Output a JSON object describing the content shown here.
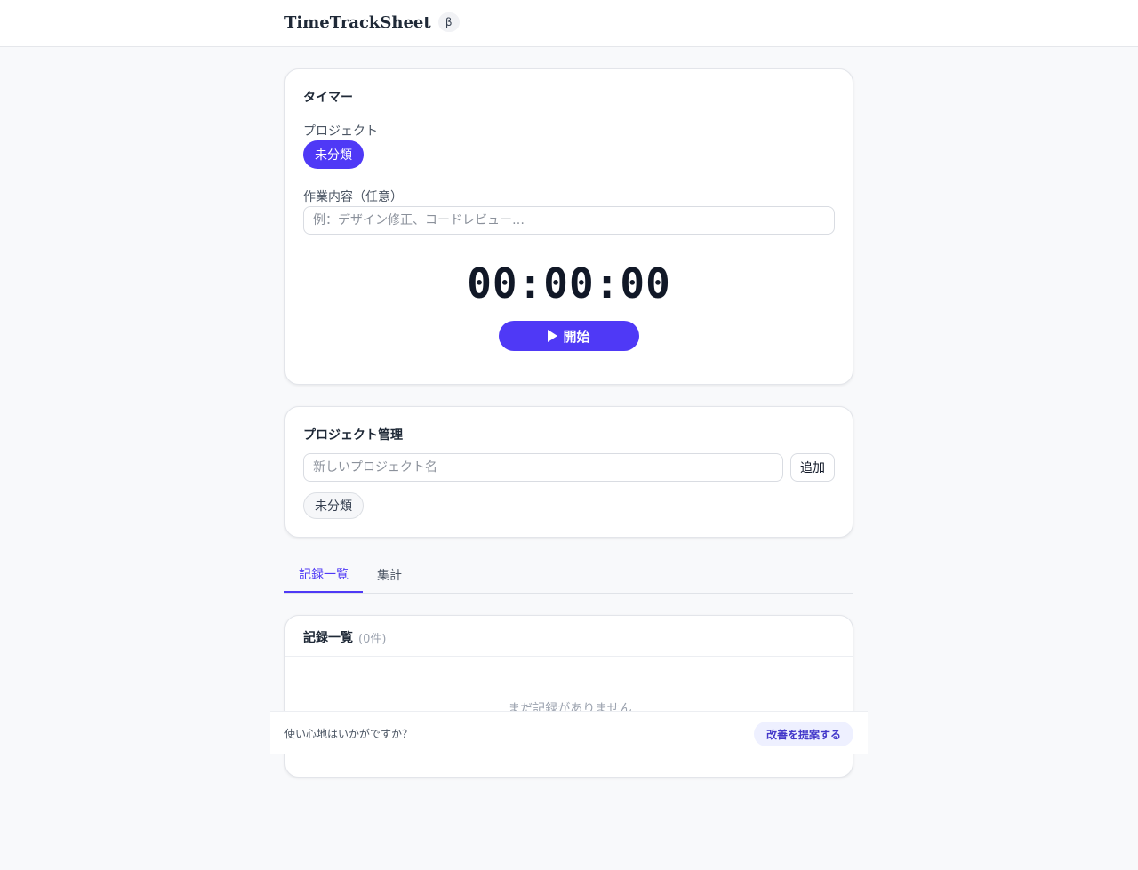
{
  "app": {
    "name": "TimeTrackSheet",
    "badge": "β"
  },
  "timer_card": {
    "title": "タイマー",
    "project_label": "プロジェクト",
    "selected_project": "未分類",
    "task_label": "作業内容（任意）",
    "task_placeholder": "例：デザイン修正、コードレビュー…",
    "task_value": "",
    "display": "00:00:00",
    "start_label": "開始",
    "start_icon": "play-icon"
  },
  "project_card": {
    "title": "プロジェクト管理",
    "new_project_placeholder": "新しいプロジェクト名",
    "add_label": "追加",
    "projects": [
      "未分類"
    ]
  },
  "tabs": [
    {
      "label": "記録一覧",
      "active": true
    },
    {
      "label": "集計",
      "active": false
    }
  ],
  "records_card": {
    "title": "記録一覧",
    "count": "(0件)",
    "empty_message": "まだ記録がありません"
  },
  "feedback": {
    "prompt": "使い心地はいかがですか？",
    "button_label": "改善を提案する"
  },
  "colors": {
    "accent": "#4f39f6",
    "background": "#f8f9fb"
  }
}
